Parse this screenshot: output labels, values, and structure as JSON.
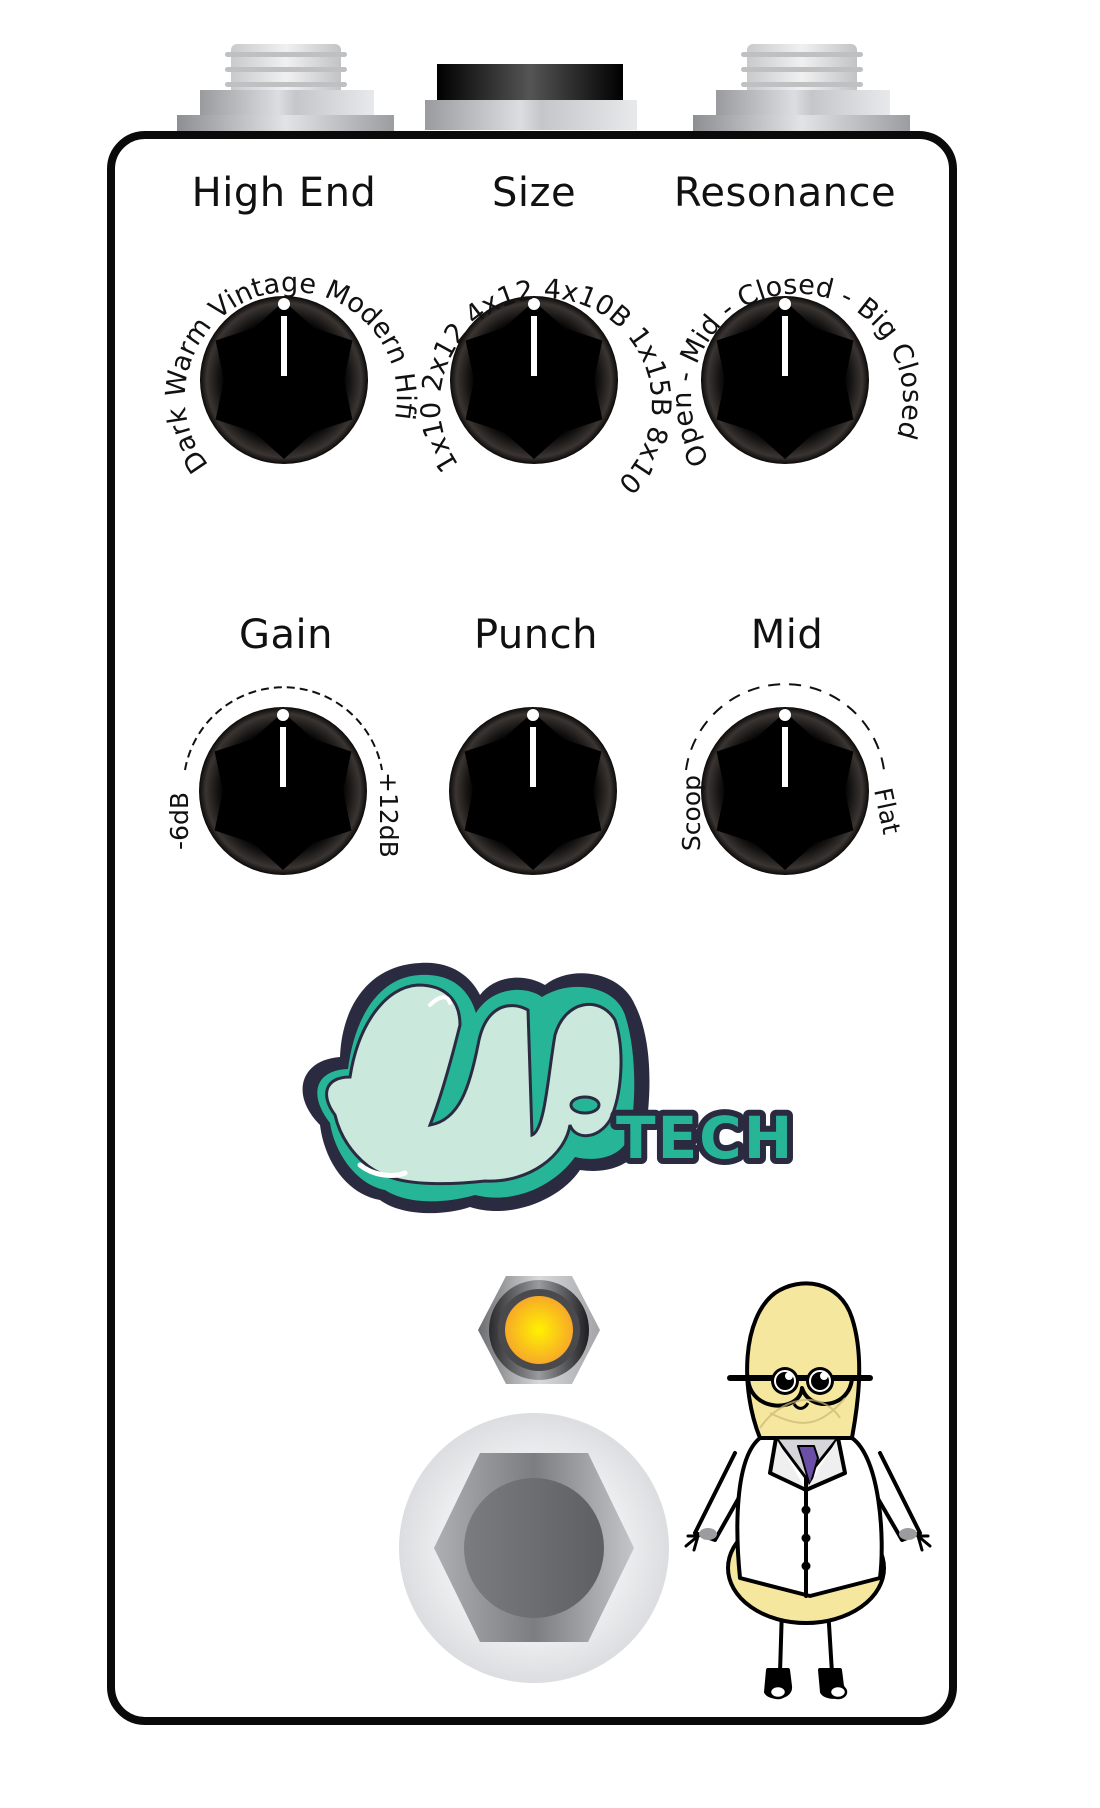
{
  "pedal": {
    "brand": "GUP TECH",
    "logo": {
      "main": "gup",
      "sub": "TECH",
      "colors": {
        "fill": "#cbe8dc",
        "shade": "#27b597",
        "outline": "#2a2b40"
      }
    },
    "enclosure_color": "#ffffff",
    "outline_color": "#0a0a0a"
  },
  "jacks": [
    {
      "name": "input-jack",
      "type": "quarter-inch"
    },
    {
      "name": "power-jack",
      "type": "dc"
    },
    {
      "name": "output-jack",
      "type": "quarter-inch"
    }
  ],
  "knobs": [
    {
      "id": "high-end",
      "label": "High End",
      "scale": "Dark Warm Vintage Modern Hifi",
      "scale_style": "arc-text",
      "position": 0.5
    },
    {
      "id": "size",
      "label": "Size",
      "scale": "1x10 2x12 4x12 4x10B 1x15B 8x10",
      "scale_style": "arc-text",
      "position": 0.5
    },
    {
      "id": "resonance",
      "label": "Resonance",
      "scale": "Open - Mid - Closed - Big Closed",
      "scale_style": "arc-text",
      "position": 0.5
    },
    {
      "id": "gain",
      "label": "Gain",
      "scale_min": "-6dB",
      "scale_max": "+12dB",
      "scale_style": "dashed-arc",
      "position": 0.5
    },
    {
      "id": "punch",
      "label": "Punch",
      "scale_style": "none",
      "position": 0.5
    },
    {
      "id": "mid",
      "label": "Mid",
      "scale_min": "Scoop",
      "scale_max": "Flat",
      "scale_style": "dashed-arc",
      "position": 0.5
    }
  ],
  "led": {
    "state": "on",
    "color": "#ffd21a"
  },
  "footswitch": {
    "name": "bypass-footswitch"
  },
  "mascot": {
    "description": "peanut scientist with glasses and lab coat",
    "tie_color": "#6b4fa6",
    "skin_color": "#f6e79f"
  }
}
